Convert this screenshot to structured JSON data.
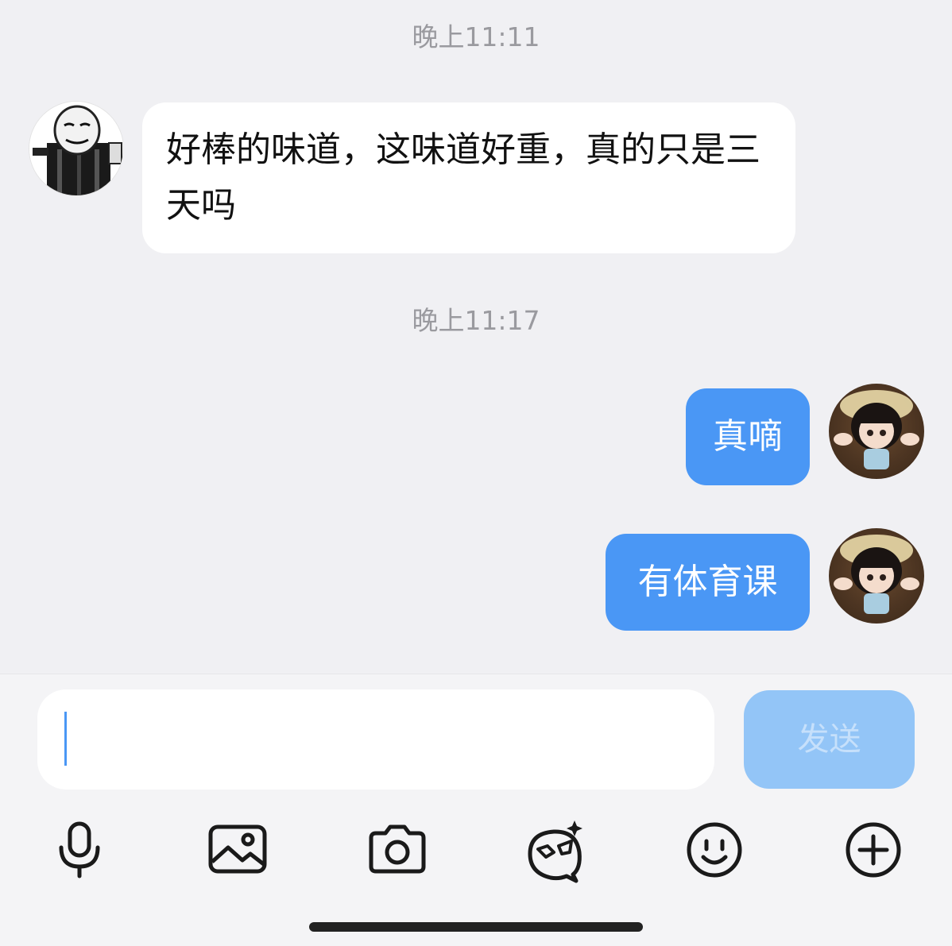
{
  "chat": {
    "timestamps": [
      "晚上11:11",
      "晚上11:17"
    ],
    "messages": [
      {
        "sender": "other",
        "text": "好棒的味道，这味道好重，真的只是三天吗"
      },
      {
        "sender": "self",
        "text": "真嘀"
      },
      {
        "sender": "self",
        "text": "有体育课"
      }
    ]
  },
  "composer": {
    "input_value": "",
    "send_label": "发送"
  },
  "toolbar": {
    "icons": [
      "microphone-icon",
      "image-icon",
      "camera-icon",
      "sticker-icon",
      "emoji-icon",
      "plus-icon"
    ]
  },
  "colors": {
    "outgoing_bubble": "#4a97f5",
    "send_button_disabled": "#93c5f7",
    "chat_background": "#f0f0f3"
  }
}
